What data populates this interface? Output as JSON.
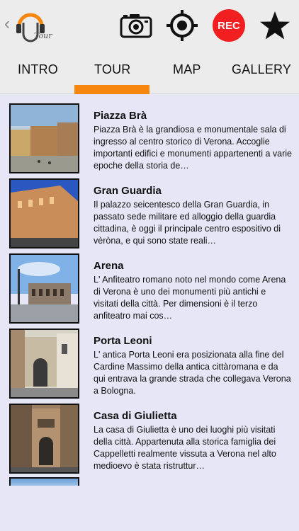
{
  "header": {
    "logo_text": "Tour",
    "icons": {
      "camera": "camera-icon",
      "location": "target-icon",
      "record": "rec-button",
      "favorite": "star-icon"
    },
    "rec_label": "REC",
    "colors": {
      "rec": "#f21f20",
      "accent": "#f7860f"
    }
  },
  "tabs": [
    {
      "label": "INTRO"
    },
    {
      "label": "TOUR",
      "active": true
    },
    {
      "label": "MAP"
    },
    {
      "label": "GALLERY"
    }
  ],
  "items": [
    {
      "title": "Piazza Brà",
      "description": "Piazza Brà è la grandiosa e monumentale sala di ingresso al centro storico di Verona. Accoglie importanti edifici e monumenti appartenenti a varie epoche della storia de…"
    },
    {
      "title": "Gran Guardia",
      "description": "Il palazzo seicentesco della Gran Guardia, in passato sede militare ed alloggio della guardia cittadina, è oggi  il principale centro espositivo di vèròna, e qui sono state reali…"
    },
    {
      "title": "Arena",
      "description": "L' Anfiteatro romano noto nel mondo come Arena di Verona è uno dei monumenti più antichi e visitati della città. Per dimensioni è il terzo anfiteatro mai cos…"
    },
    {
      "title": "Porta Leoni",
      "description": "L' antica Porta Leoni era posizionata alla fine del Cardine Massimo della antica cittàromana e da qui entrava la grande strada che collegava Verona a Bologna."
    },
    {
      "title": "Casa di Giulietta",
      "description": "La casa di Giulietta è uno dei luoghi più visitati della città. Appartenuta alla storica famiglia dei Cappelletti realmente vissuta a Verona nel alto medioevo è stata ristruttur…"
    }
  ]
}
